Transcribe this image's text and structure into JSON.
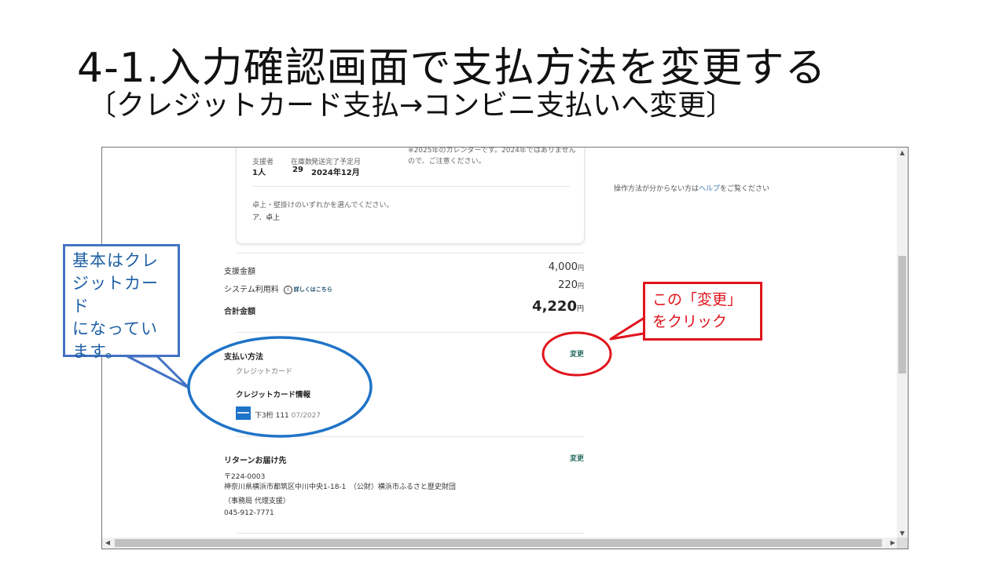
{
  "slide": {
    "title": "4-1.入力確認画面で支払方法を変更する",
    "subtitle": "〔クレジットカード支払→コンビニ支払いへ変更〕"
  },
  "page": {
    "calendar_note": "※2025年のカレンダーです。2024年ではありませんので、ご注意ください。",
    "supporters_label": "支援者",
    "supporters_value": "1人",
    "stock_label": "在庫数",
    "stock_value": "29",
    "ship_label": "発送完了予定月",
    "ship_value": "2024年12月",
    "option_question": "卓上・壁掛けのいずれかを選んでください。",
    "option_answer": "ア．卓上",
    "help_text": "操作方法が分からない方は",
    "help_link": "ヘルプ",
    "help_suffix": "をご覧ください",
    "support_amount_label": "支援金額",
    "support_amount_value": "4,000",
    "system_fee_label": "システム利用料",
    "info_icon": "i",
    "details_link": "詳しくはこちら",
    "system_fee_value": "220",
    "total_label": "合計金額",
    "total_value": "4,220",
    "currency": "円",
    "payment_method_label": "支払い方法",
    "payment_method_value": "クレジットカード",
    "change_label": "変更",
    "card_info_label": "クレジットカード情報",
    "card_last_digits": "下3桁 111",
    "card_expiry": "07/2027",
    "return_address_label": "リターンお届け先",
    "postal_code": "〒224-0003",
    "address_line": "神奈川県横浜市都筑区中川中央1-18-1　（公財）横浜市ふるさと歴史財団",
    "address_note": "（事務局 代理支援）",
    "phone": "045-912-7771"
  },
  "callouts": {
    "blue_lines": [
      "基本はクレ",
      "ジットカード",
      "になってい",
      "ます。"
    ],
    "red_lines": [
      "この「変更」",
      "をクリック"
    ]
  },
  "scrollbar": {
    "up": "▲",
    "down": "▼",
    "left": "◀",
    "right": "▶"
  },
  "colors": {
    "callout_blue": "#4472c4",
    "ellipse_blue": "#1f73c8",
    "callout_red": "#e0141c",
    "change_link": "#2b6e64"
  }
}
